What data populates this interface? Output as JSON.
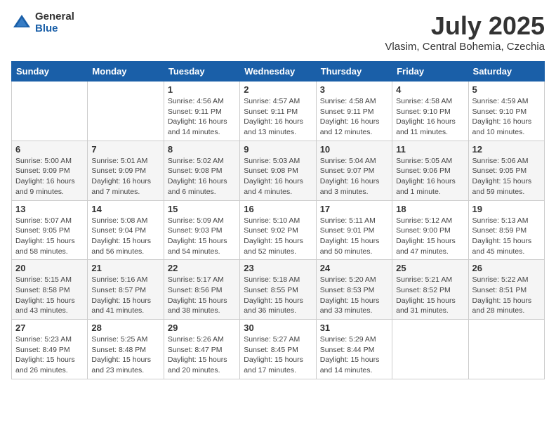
{
  "logo": {
    "general": "General",
    "blue": "Blue"
  },
  "header": {
    "title": "July 2025",
    "subtitle": "Vlasim, Central Bohemia, Czechia"
  },
  "weekdays": [
    "Sunday",
    "Monday",
    "Tuesday",
    "Wednesday",
    "Thursday",
    "Friday",
    "Saturday"
  ],
  "weeks": [
    [
      {
        "day": "",
        "sunrise": "",
        "sunset": "",
        "daylight": ""
      },
      {
        "day": "",
        "sunrise": "",
        "sunset": "",
        "daylight": ""
      },
      {
        "day": "1",
        "sunrise": "Sunrise: 4:56 AM",
        "sunset": "Sunset: 9:11 PM",
        "daylight": "Daylight: 16 hours and 14 minutes."
      },
      {
        "day": "2",
        "sunrise": "Sunrise: 4:57 AM",
        "sunset": "Sunset: 9:11 PM",
        "daylight": "Daylight: 16 hours and 13 minutes."
      },
      {
        "day": "3",
        "sunrise": "Sunrise: 4:58 AM",
        "sunset": "Sunset: 9:11 PM",
        "daylight": "Daylight: 16 hours and 12 minutes."
      },
      {
        "day": "4",
        "sunrise": "Sunrise: 4:58 AM",
        "sunset": "Sunset: 9:10 PM",
        "daylight": "Daylight: 16 hours and 11 minutes."
      },
      {
        "day": "5",
        "sunrise": "Sunrise: 4:59 AM",
        "sunset": "Sunset: 9:10 PM",
        "daylight": "Daylight: 16 hours and 10 minutes."
      }
    ],
    [
      {
        "day": "6",
        "sunrise": "Sunrise: 5:00 AM",
        "sunset": "Sunset: 9:09 PM",
        "daylight": "Daylight: 16 hours and 9 minutes."
      },
      {
        "day": "7",
        "sunrise": "Sunrise: 5:01 AM",
        "sunset": "Sunset: 9:09 PM",
        "daylight": "Daylight: 16 hours and 7 minutes."
      },
      {
        "day": "8",
        "sunrise": "Sunrise: 5:02 AM",
        "sunset": "Sunset: 9:08 PM",
        "daylight": "Daylight: 16 hours and 6 minutes."
      },
      {
        "day": "9",
        "sunrise": "Sunrise: 5:03 AM",
        "sunset": "Sunset: 9:08 PM",
        "daylight": "Daylight: 16 hours and 4 minutes."
      },
      {
        "day": "10",
        "sunrise": "Sunrise: 5:04 AM",
        "sunset": "Sunset: 9:07 PM",
        "daylight": "Daylight: 16 hours and 3 minutes."
      },
      {
        "day": "11",
        "sunrise": "Sunrise: 5:05 AM",
        "sunset": "Sunset: 9:06 PM",
        "daylight": "Daylight: 16 hours and 1 minute."
      },
      {
        "day": "12",
        "sunrise": "Sunrise: 5:06 AM",
        "sunset": "Sunset: 9:05 PM",
        "daylight": "Daylight: 15 hours and 59 minutes."
      }
    ],
    [
      {
        "day": "13",
        "sunrise": "Sunrise: 5:07 AM",
        "sunset": "Sunset: 9:05 PM",
        "daylight": "Daylight: 15 hours and 58 minutes."
      },
      {
        "day": "14",
        "sunrise": "Sunrise: 5:08 AM",
        "sunset": "Sunset: 9:04 PM",
        "daylight": "Daylight: 15 hours and 56 minutes."
      },
      {
        "day": "15",
        "sunrise": "Sunrise: 5:09 AM",
        "sunset": "Sunset: 9:03 PM",
        "daylight": "Daylight: 15 hours and 54 minutes."
      },
      {
        "day": "16",
        "sunrise": "Sunrise: 5:10 AM",
        "sunset": "Sunset: 9:02 PM",
        "daylight": "Daylight: 15 hours and 52 minutes."
      },
      {
        "day": "17",
        "sunrise": "Sunrise: 5:11 AM",
        "sunset": "Sunset: 9:01 PM",
        "daylight": "Daylight: 15 hours and 50 minutes."
      },
      {
        "day": "18",
        "sunrise": "Sunrise: 5:12 AM",
        "sunset": "Sunset: 9:00 PM",
        "daylight": "Daylight: 15 hours and 47 minutes."
      },
      {
        "day": "19",
        "sunrise": "Sunrise: 5:13 AM",
        "sunset": "Sunset: 8:59 PM",
        "daylight": "Daylight: 15 hours and 45 minutes."
      }
    ],
    [
      {
        "day": "20",
        "sunrise": "Sunrise: 5:15 AM",
        "sunset": "Sunset: 8:58 PM",
        "daylight": "Daylight: 15 hours and 43 minutes."
      },
      {
        "day": "21",
        "sunrise": "Sunrise: 5:16 AM",
        "sunset": "Sunset: 8:57 PM",
        "daylight": "Daylight: 15 hours and 41 minutes."
      },
      {
        "day": "22",
        "sunrise": "Sunrise: 5:17 AM",
        "sunset": "Sunset: 8:56 PM",
        "daylight": "Daylight: 15 hours and 38 minutes."
      },
      {
        "day": "23",
        "sunrise": "Sunrise: 5:18 AM",
        "sunset": "Sunset: 8:55 PM",
        "daylight": "Daylight: 15 hours and 36 minutes."
      },
      {
        "day": "24",
        "sunrise": "Sunrise: 5:20 AM",
        "sunset": "Sunset: 8:53 PM",
        "daylight": "Daylight: 15 hours and 33 minutes."
      },
      {
        "day": "25",
        "sunrise": "Sunrise: 5:21 AM",
        "sunset": "Sunset: 8:52 PM",
        "daylight": "Daylight: 15 hours and 31 minutes."
      },
      {
        "day": "26",
        "sunrise": "Sunrise: 5:22 AM",
        "sunset": "Sunset: 8:51 PM",
        "daylight": "Daylight: 15 hours and 28 minutes."
      }
    ],
    [
      {
        "day": "27",
        "sunrise": "Sunrise: 5:23 AM",
        "sunset": "Sunset: 8:49 PM",
        "daylight": "Daylight: 15 hours and 26 minutes."
      },
      {
        "day": "28",
        "sunrise": "Sunrise: 5:25 AM",
        "sunset": "Sunset: 8:48 PM",
        "daylight": "Daylight: 15 hours and 23 minutes."
      },
      {
        "day": "29",
        "sunrise": "Sunrise: 5:26 AM",
        "sunset": "Sunset: 8:47 PM",
        "daylight": "Daylight: 15 hours and 20 minutes."
      },
      {
        "day": "30",
        "sunrise": "Sunrise: 5:27 AM",
        "sunset": "Sunset: 8:45 PM",
        "daylight": "Daylight: 15 hours and 17 minutes."
      },
      {
        "day": "31",
        "sunrise": "Sunrise: 5:29 AM",
        "sunset": "Sunset: 8:44 PM",
        "daylight": "Daylight: 15 hours and 14 minutes."
      },
      {
        "day": "",
        "sunrise": "",
        "sunset": "",
        "daylight": ""
      },
      {
        "day": "",
        "sunrise": "",
        "sunset": "",
        "daylight": ""
      }
    ]
  ]
}
